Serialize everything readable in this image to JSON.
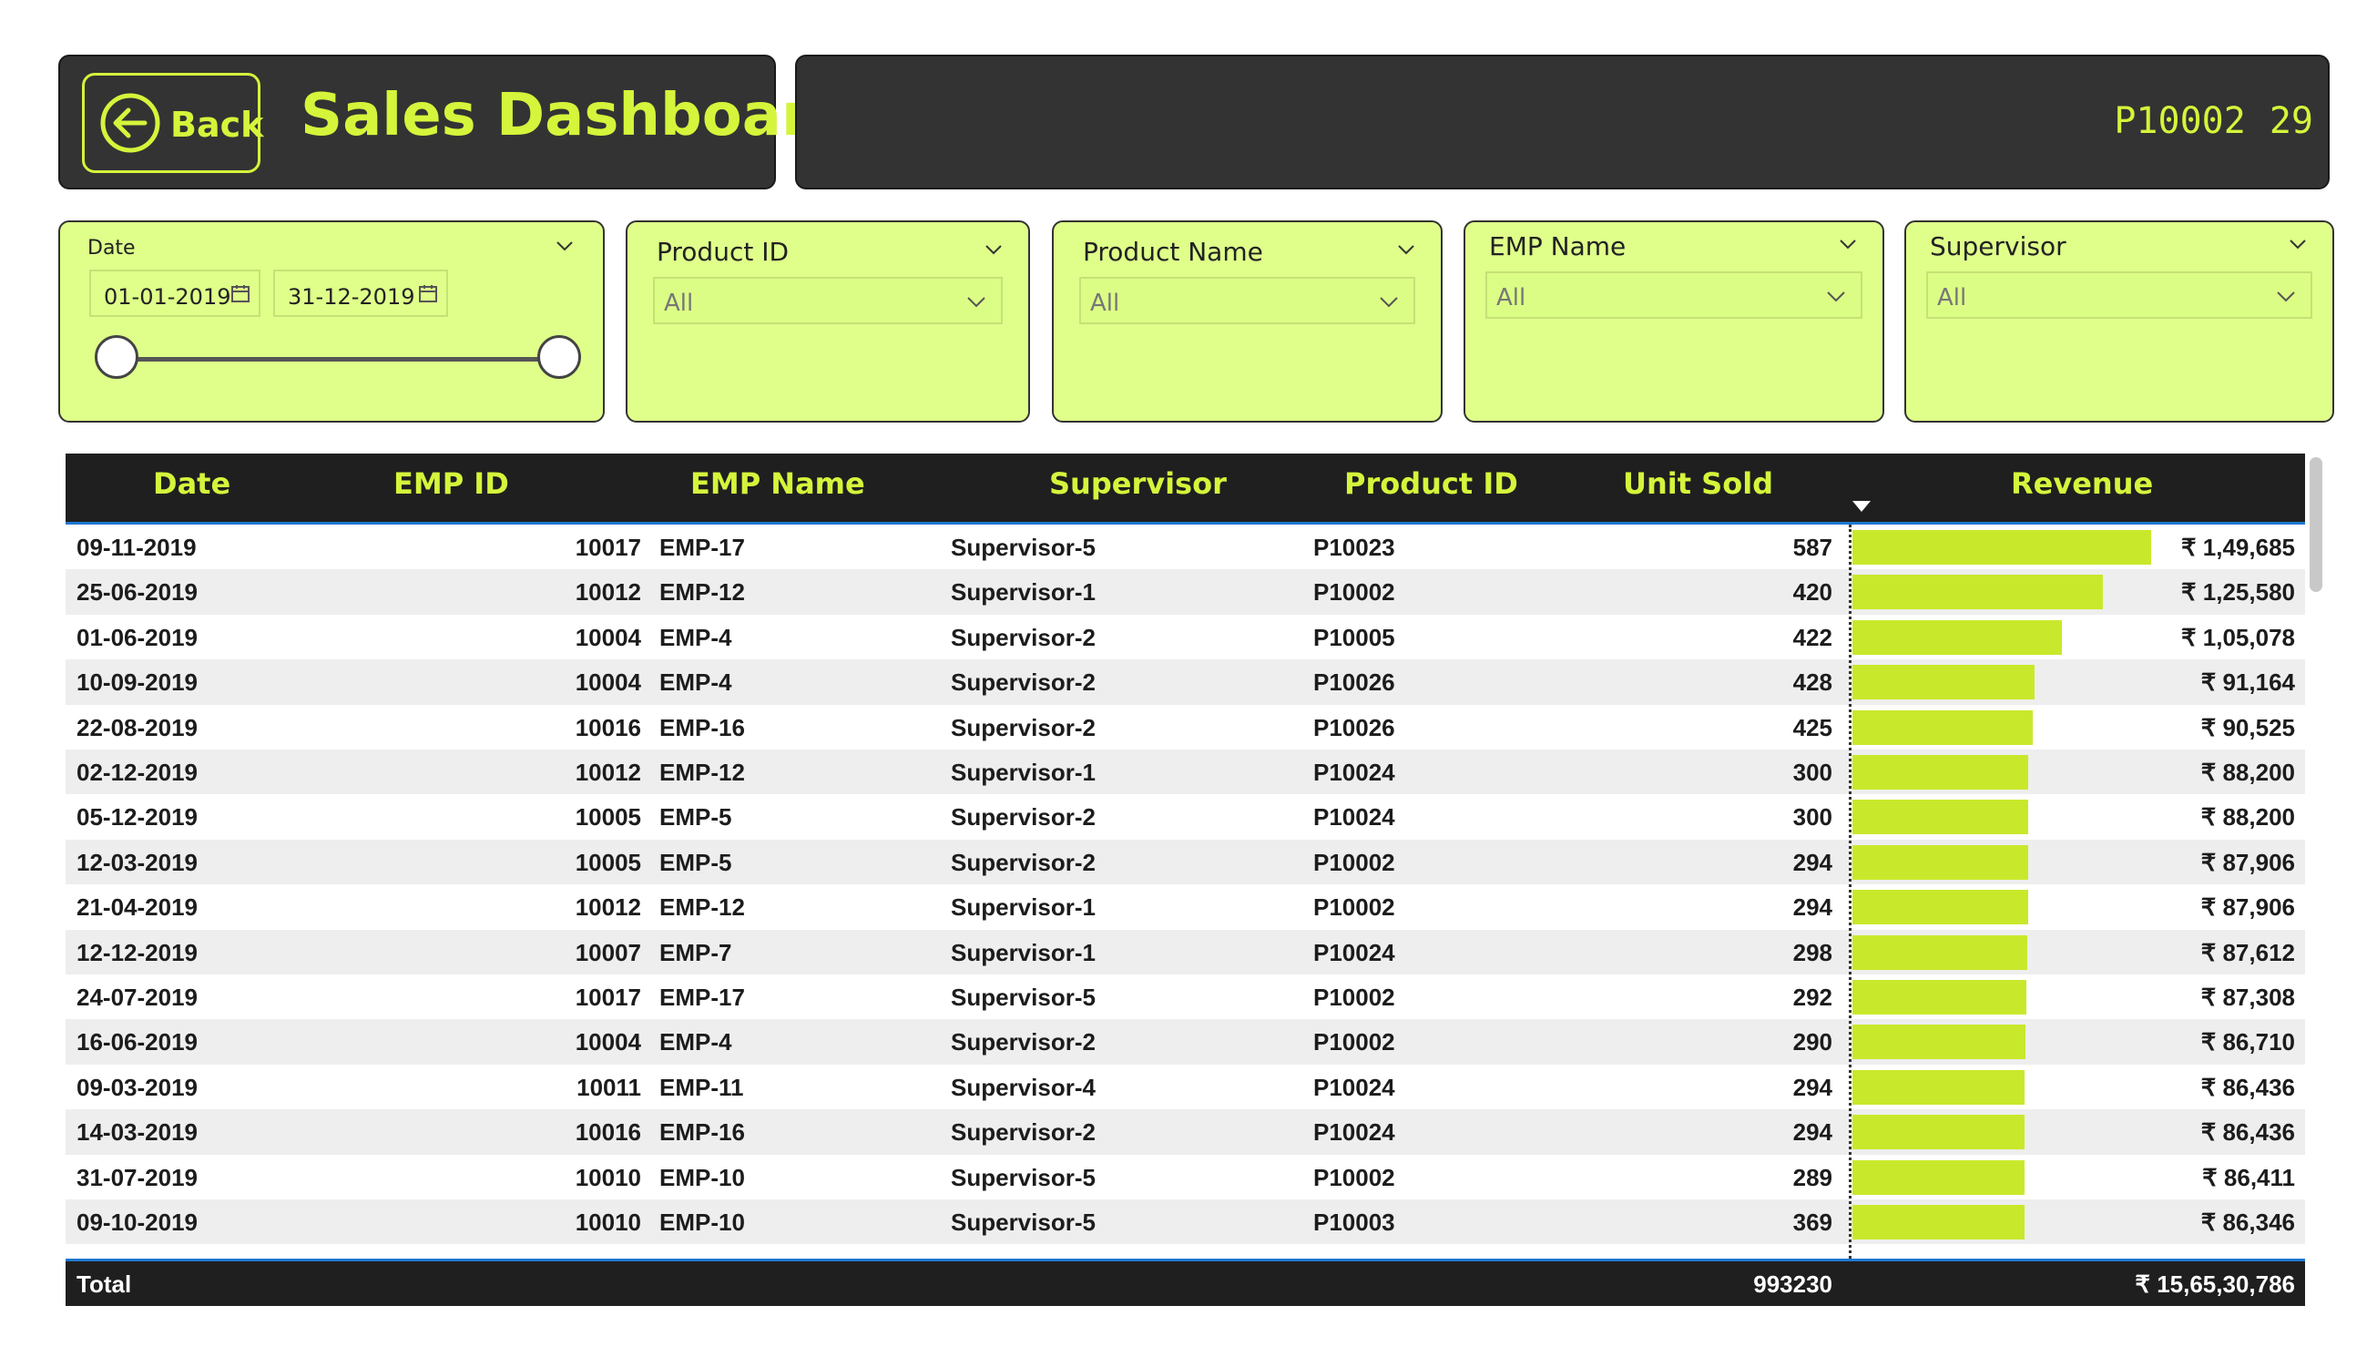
{
  "header": {
    "back_label": "Back",
    "title": "Sales Dashboard",
    "kpi_product": "P10002",
    "kpi_value": "29"
  },
  "slicers": {
    "date": {
      "title": "Date",
      "start": "01-01-2019",
      "end": "31-12-2019"
    },
    "product_id": {
      "title": "Product ID",
      "value": "All"
    },
    "product_name": {
      "title": "Product Name",
      "value": "All"
    },
    "emp_name": {
      "title": "EMP Name",
      "value": "All"
    },
    "supervisor": {
      "title": "Supervisor",
      "value": "All"
    }
  },
  "table": {
    "columns": [
      "Date",
      "EMP ID",
      "EMP Name",
      "Supervisor",
      "Product ID",
      "Unit Sold",
      "Revenue"
    ],
    "rows": [
      {
        "date": "09-11-2019",
        "emp_id": "10017",
        "emp_name": "EMP-17",
        "supervisor": "Supervisor-5",
        "product_id": "P10023",
        "units": "587",
        "revenue": "₹ 1,49,685",
        "revenue_value": 149685
      },
      {
        "date": "25-06-2019",
        "emp_id": "10012",
        "emp_name": "EMP-12",
        "supervisor": "Supervisor-1",
        "product_id": "P10002",
        "units": "420",
        "revenue": "₹ 1,25,580",
        "revenue_value": 125580
      },
      {
        "date": "01-06-2019",
        "emp_id": "10004",
        "emp_name": "EMP-4",
        "supervisor": "Supervisor-2",
        "product_id": "P10005",
        "units": "422",
        "revenue": "₹ 1,05,078",
        "revenue_value": 105078
      },
      {
        "date": "10-09-2019",
        "emp_id": "10004",
        "emp_name": "EMP-4",
        "supervisor": "Supervisor-2",
        "product_id": "P10026",
        "units": "428",
        "revenue": "₹ 91,164",
        "revenue_value": 91164
      },
      {
        "date": "22-08-2019",
        "emp_id": "10016",
        "emp_name": "EMP-16",
        "supervisor": "Supervisor-2",
        "product_id": "P10026",
        "units": "425",
        "revenue": "₹ 90,525",
        "revenue_value": 90525
      },
      {
        "date": "02-12-2019",
        "emp_id": "10012",
        "emp_name": "EMP-12",
        "supervisor": "Supervisor-1",
        "product_id": "P10024",
        "units": "300",
        "revenue": "₹ 88,200",
        "revenue_value": 88200
      },
      {
        "date": "05-12-2019",
        "emp_id": "10005",
        "emp_name": "EMP-5",
        "supervisor": "Supervisor-2",
        "product_id": "P10024",
        "units": "300",
        "revenue": "₹ 88,200",
        "revenue_value": 88200
      },
      {
        "date": "12-03-2019",
        "emp_id": "10005",
        "emp_name": "EMP-5",
        "supervisor": "Supervisor-2",
        "product_id": "P10002",
        "units": "294",
        "revenue": "₹ 87,906",
        "revenue_value": 87906
      },
      {
        "date": "21-04-2019",
        "emp_id": "10012",
        "emp_name": "EMP-12",
        "supervisor": "Supervisor-1",
        "product_id": "P10002",
        "units": "294",
        "revenue": "₹ 87,906",
        "revenue_value": 87906
      },
      {
        "date": "12-12-2019",
        "emp_id": "10007",
        "emp_name": "EMP-7",
        "supervisor": "Supervisor-1",
        "product_id": "P10024",
        "units": "298",
        "revenue": "₹ 87,612",
        "revenue_value": 87612
      },
      {
        "date": "24-07-2019",
        "emp_id": "10017",
        "emp_name": "EMP-17",
        "supervisor": "Supervisor-5",
        "product_id": "P10002",
        "units": "292",
        "revenue": "₹ 87,308",
        "revenue_value": 87308
      },
      {
        "date": "16-06-2019",
        "emp_id": "10004",
        "emp_name": "EMP-4",
        "supervisor": "Supervisor-2",
        "product_id": "P10002",
        "units": "290",
        "revenue": "₹ 86,710",
        "revenue_value": 86710
      },
      {
        "date": "09-03-2019",
        "emp_id": "10011",
        "emp_name": "EMP-11",
        "supervisor": "Supervisor-4",
        "product_id": "P10024",
        "units": "294",
        "revenue": "₹ 86,436",
        "revenue_value": 86436
      },
      {
        "date": "14-03-2019",
        "emp_id": "10016",
        "emp_name": "EMP-16",
        "supervisor": "Supervisor-2",
        "product_id": "P10024",
        "units": "294",
        "revenue": "₹ 86,436",
        "revenue_value": 86436
      },
      {
        "date": "31-07-2019",
        "emp_id": "10010",
        "emp_name": "EMP-10",
        "supervisor": "Supervisor-5",
        "product_id": "P10002",
        "units": "289",
        "revenue": "₹ 86,411",
        "revenue_value": 86411
      },
      {
        "date": "09-10-2019",
        "emp_id": "10010",
        "emp_name": "EMP-10",
        "supervisor": "Supervisor-5",
        "product_id": "P10003",
        "units": "369",
        "revenue": "₹ 86,346",
        "revenue_value": 86346
      }
    ],
    "total": {
      "label": "Total",
      "units": "993230",
      "revenue": "₹ 15,65,30,786"
    }
  },
  "colors": {
    "accent": "#d4f53b",
    "panel": "#333333",
    "slicer_bg": "#dfff8a",
    "bar": "#c8e92b",
    "header_bg": "#1f1f1f",
    "highlight": "#1f78d1"
  }
}
